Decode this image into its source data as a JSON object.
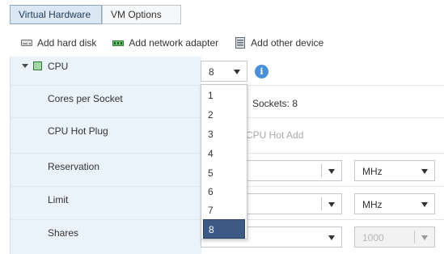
{
  "tabs": [
    {
      "label": "Virtual Hardware",
      "active": true
    },
    {
      "label": "VM Options",
      "active": false
    }
  ],
  "toolbar": {
    "add_hard_disk": "Add hard disk",
    "add_network_adapter": "Add network adapter",
    "add_other_device": "Add other device"
  },
  "cpu": {
    "label": "CPU",
    "select_value": "8",
    "options": [
      "1",
      "2",
      "3",
      "4",
      "5",
      "6",
      "7",
      "8"
    ],
    "selected_option": "8"
  },
  "rows": {
    "cores_per_socket": {
      "label": "Cores per Socket",
      "info": "Sockets: 8"
    },
    "cpu_hot_plug": {
      "label": "CPU Hot Plug",
      "info": "CPU Hot Add"
    },
    "reservation": {
      "label": "Reservation",
      "unit": "MHz"
    },
    "limit": {
      "label": "Limit",
      "unit": "MHz"
    },
    "shares": {
      "label": "Shares",
      "value": "1000"
    }
  },
  "colors": {
    "label_column_bg": "#eaf2fa",
    "selected_option_bg": "#3c5a84",
    "info_icon": "#4a90d9"
  }
}
